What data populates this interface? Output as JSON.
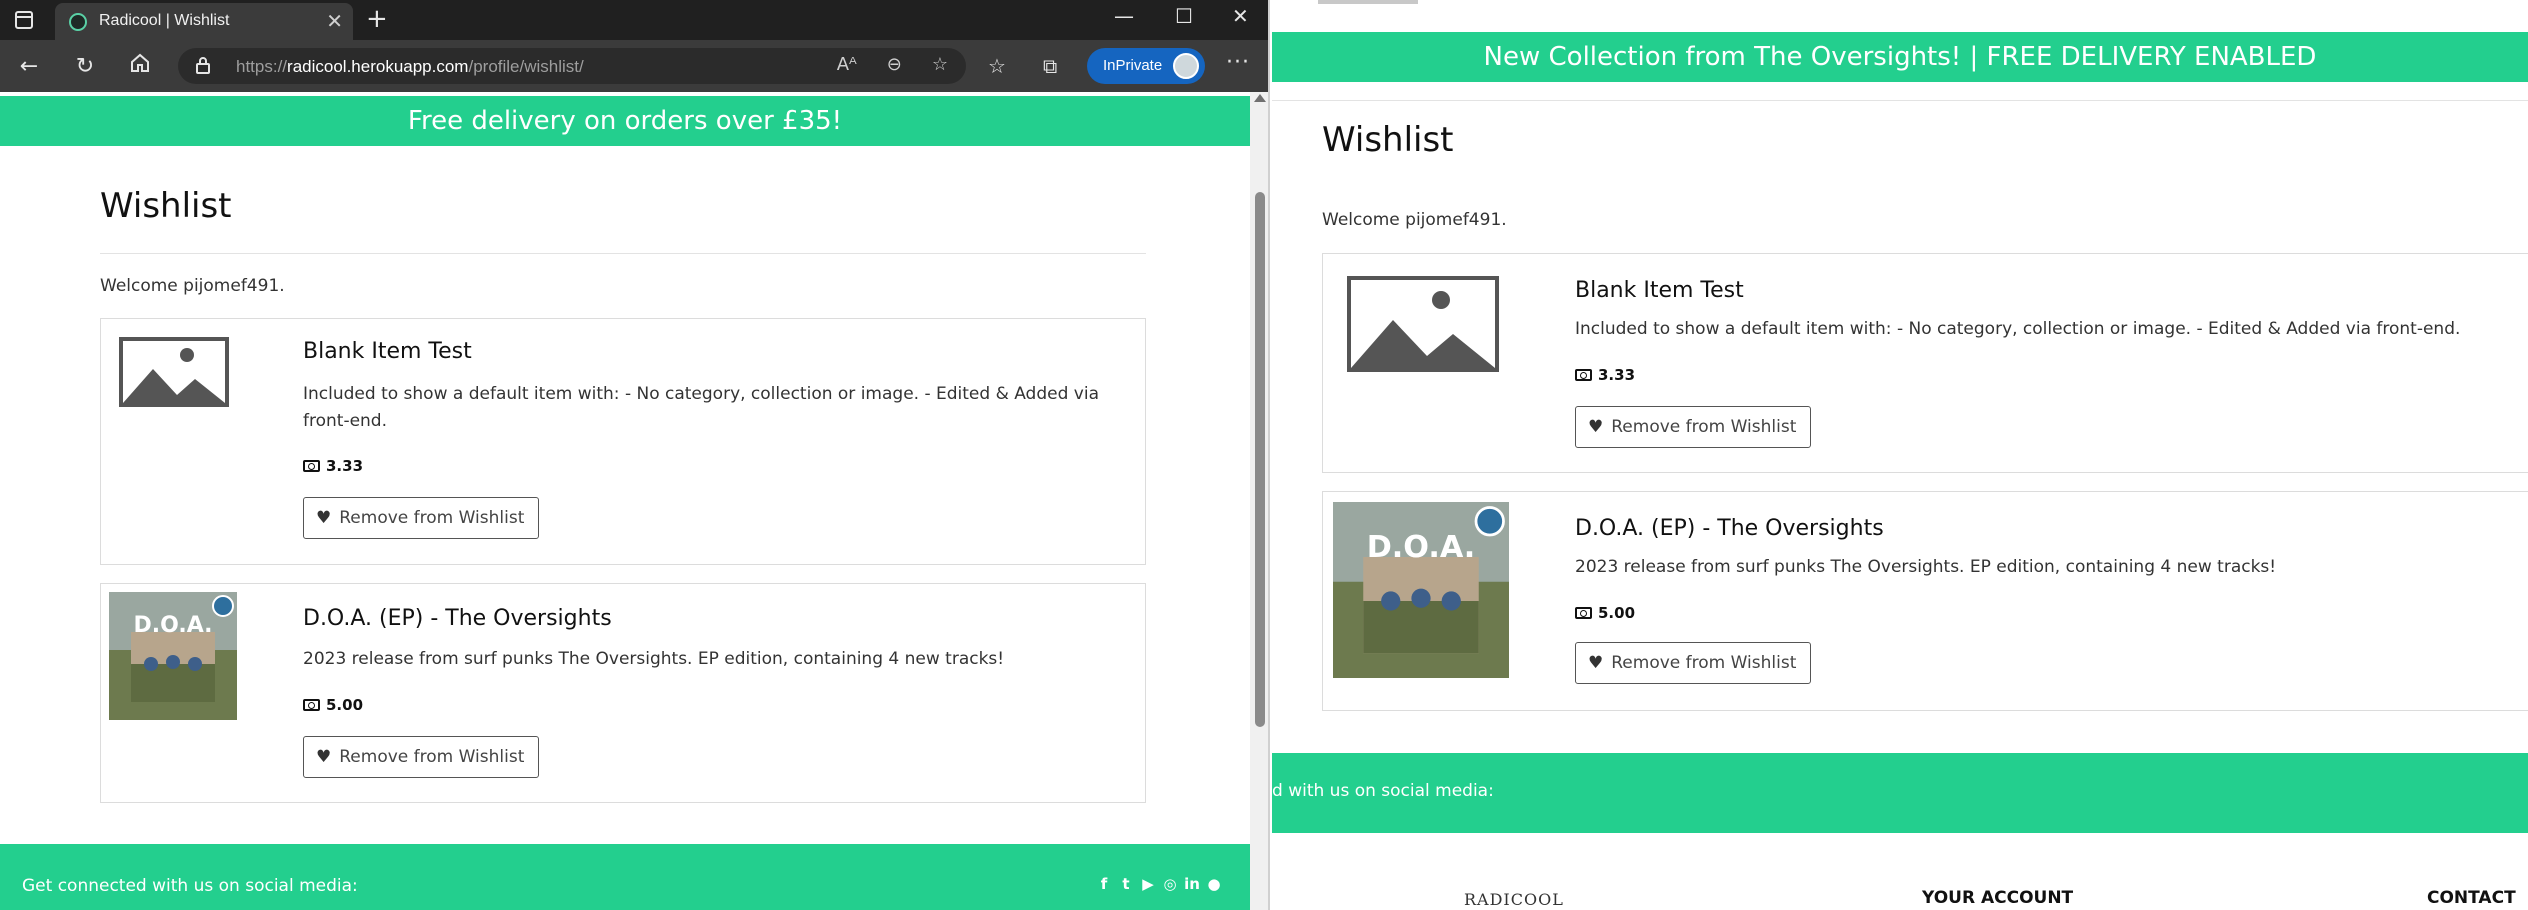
{
  "browser": {
    "tab_title": "Radicool | Wishlist",
    "tab_close": "✕",
    "new_tab": "+",
    "url_prefix": "https://",
    "url_host": "radicool.herokuapp.com",
    "url_path": "/profile/wishlist/",
    "inprivate_label": "InPrivate",
    "icons": [
      "tab-actions-icon",
      "back-icon",
      "refresh-icon",
      "home-icon",
      "lock-icon",
      "read-aloud-icon",
      "zoom-icon",
      "add-favorite-icon",
      "favorites-icon",
      "collections-icon",
      "more-icon",
      "minimize-icon",
      "maximize-icon",
      "close-icon"
    ]
  },
  "left": {
    "banner": "Free delivery on orders over £35!",
    "title": "Wishlist",
    "welcome": "Welcome pijomef491.",
    "items": [
      {
        "name": "Blank Item Test",
        "description": "Included to show a default item with: - No category, collection or image. - Edited & Added via front-end.",
        "price": "3.33",
        "remove_label": "Remove from Wishlist"
      },
      {
        "name": "D.O.A. (EP) - The Oversights",
        "description": "2023 release from surf punks The Oversights. EP edition, containing 4 new tracks!",
        "price": "5.00",
        "remove_label": "Remove from Wishlist"
      }
    ],
    "footer_text": "Get connected with us on social media:",
    "social_icons": [
      "facebook-icon",
      "twitter-icon",
      "youtube-icon",
      "instagram-icon",
      "linkedin-icon",
      "github-icon"
    ]
  },
  "right": {
    "banner": "New Collection from The Oversights! | FREE DELIVERY ENABLED",
    "title": "Wishlist",
    "welcome": "Welcome pijomef491.",
    "items": [
      {
        "name": "Blank Item Test",
        "description": "Included to show a default item with: - No category, collection or image. - Edited & Added via front-end.",
        "price": "3.33",
        "remove_label": "Remove from Wishlist"
      },
      {
        "name": "D.O.A. (EP) - The Oversights",
        "description": "2023 release from surf punks The Oversights. EP edition, containing 4 new tracks!",
        "price": "5.00",
        "remove_label": "Remove from Wishlist"
      }
    ],
    "footer_text": "d with us on social media:",
    "footer_logo": "RADICOOL",
    "footer_col_account": "YOUR ACCOUNT",
    "footer_col_contact": "CONTACT"
  },
  "album_art_text": "D.O.A.",
  "colors": {
    "brand_green": "#23cf8e",
    "browser_dark": "#202020",
    "inprivate_blue": "#1565c0"
  }
}
